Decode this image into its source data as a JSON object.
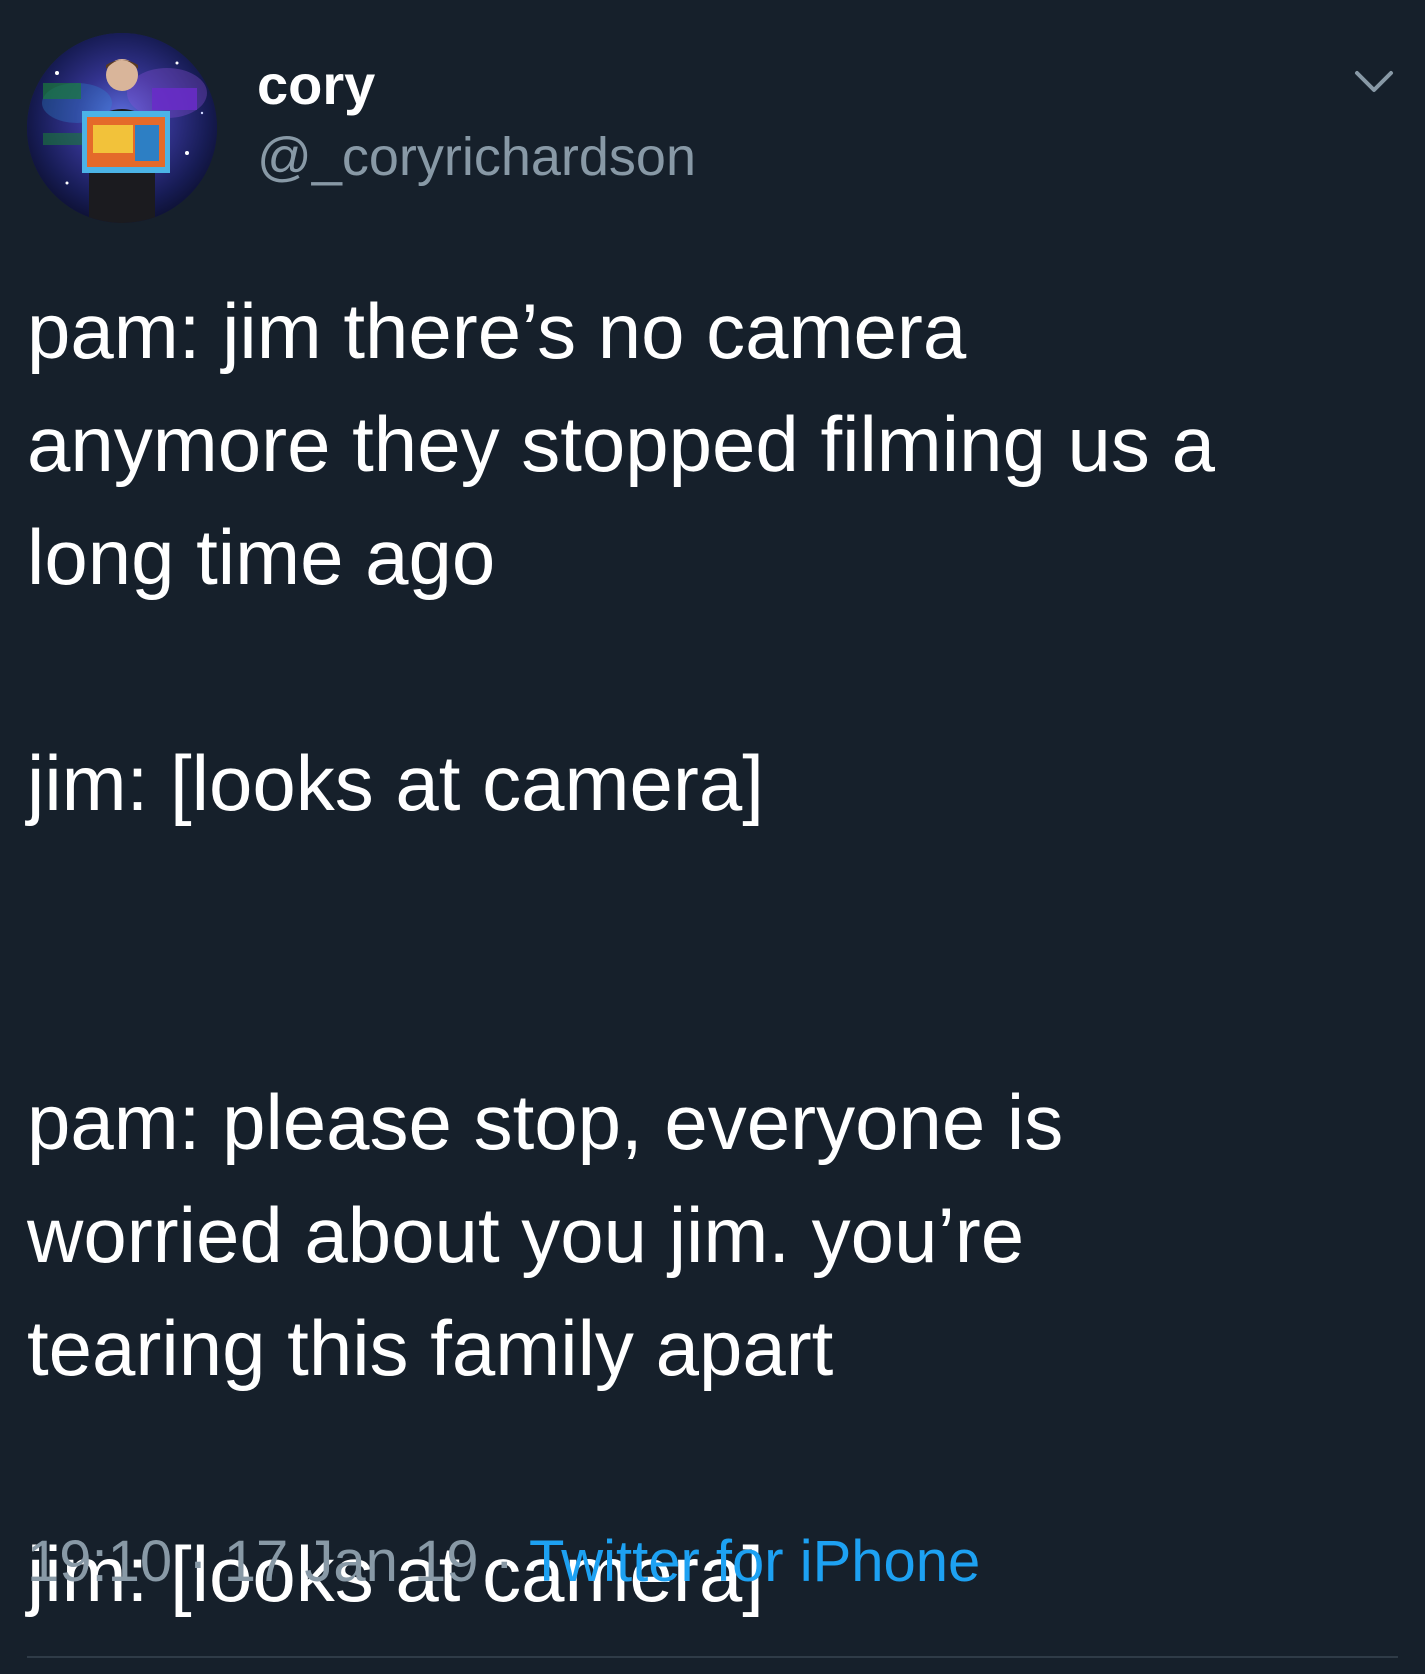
{
  "author": {
    "display_name": "cory",
    "handle": "@_coryrichardson",
    "avatar_icon": "profile-photo"
  },
  "menu_icon": "chevron-down-icon",
  "tweet": {
    "paragraphs": [
      [
        "pam: jim there’s no camera",
        "anymore they stopped filming us a",
        "long time ago"
      ],
      [
        "jim: [looks at camera]"
      ],
      [
        "pam: please stop, everyone is",
        "worried about you jim. you’re",
        "tearing this family apart"
      ],
      [
        "jim: [looks at camera]"
      ]
    ]
  },
  "meta": {
    "time": "19:10",
    "separator": " · ",
    "date": "17 Jan 19",
    "source": "Twitter for iPhone"
  },
  "colors": {
    "background": "#16202b",
    "text": "#ffffff",
    "secondary": "#8899a6",
    "link": "#1da1f2"
  }
}
